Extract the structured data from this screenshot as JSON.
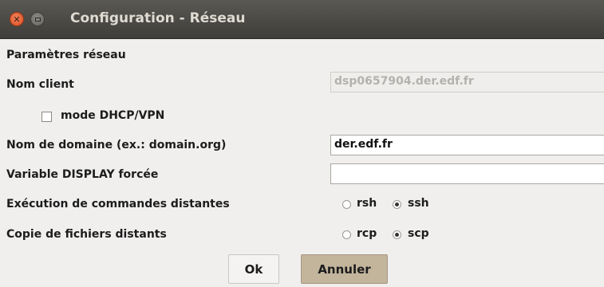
{
  "window": {
    "title": "Configuration - Réseau"
  },
  "form": {
    "section_title": "Paramètres réseau",
    "client_name_label": "Nom client",
    "client_name_value": "dsp0657904.der.edf.fr",
    "dhcp_label": "mode DHCP/VPN",
    "dhcp_checked": false,
    "domain_label": "Nom de domaine (ex.: domain.org)",
    "domain_value": "der.edf.fr",
    "display_label": "Variable DISPLAY forcée",
    "display_value": "",
    "remote_exec_label": "Exécution de commandes distantes",
    "remote_exec_options": [
      "rsh",
      "ssh"
    ],
    "remote_exec_selected": "ssh",
    "remote_copy_label": "Copie de fichiers distants",
    "remote_copy_options": [
      "rcp",
      "scp"
    ],
    "remote_copy_selected": "scp"
  },
  "buttons": {
    "ok_label": "Ok",
    "cancel_label": "Annuler"
  },
  "icons": {
    "close": "close-icon",
    "minimize": "minimize-icon"
  },
  "colors": {
    "titlebar": "#4a4944",
    "close": "#e95420",
    "cancel_button": "#c3b49c"
  }
}
